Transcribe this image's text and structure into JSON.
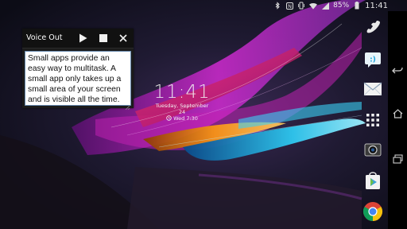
{
  "status_bar": {
    "icons": [
      "bluetooth-icon",
      "nfc-icon",
      "vibrate-icon",
      "wifi-icon",
      "signal-icon",
      "battery-icon"
    ],
    "battery_percent": "85%",
    "time": "11:41"
  },
  "lockscreen_clock": {
    "time": "11:41",
    "date": "Tuesday, September 24",
    "alarm": "Wed 7:30"
  },
  "voice_out": {
    "title": "Voice Out",
    "text": "Small apps provide an easy way to multitask. A small app only takes up a small area of your screen and is visible all the time.",
    "controls": [
      "play-icon",
      "stop-icon",
      "close-icon"
    ]
  },
  "dock": {
    "apps": [
      "phone-icon",
      "messaging-icon",
      "email-icon",
      "apps-drawer-icon",
      "camera-icon",
      "play-store-icon",
      "chrome-icon"
    ]
  },
  "nav_bar": {
    "buttons": [
      "back-icon",
      "home-icon",
      "recents-icon"
    ]
  },
  "colors": {
    "titlebar": "#111111",
    "text_border": "#6a8cb0",
    "accent_cyan": "#2ec8f0",
    "accent_magenta": "#d02ad0"
  }
}
